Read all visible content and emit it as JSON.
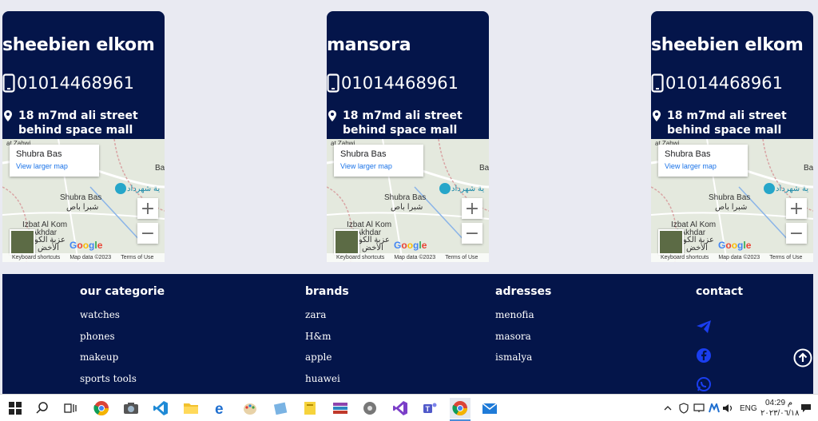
{
  "cards": [
    {
      "title": "sheebien elkom",
      "phone": "01014468961",
      "address": "18 m7md ali street behind space mall"
    },
    {
      "title": "mansora",
      "phone": "01014468961",
      "address": "18 m7md ali street behind space mall"
    },
    {
      "title": "sheebien elkom",
      "phone": "01014468961",
      "address": "18 m7md ali street behind space mall"
    }
  ],
  "map": {
    "place_name": "Shubra Bas",
    "view_larger": "View larger map",
    "town_en": "Shubra Bas",
    "town_ar": "شبرا باص",
    "izbat_en": "Izbat Al Kom",
    "izbat_en2": "l Akhdar",
    "izbat_ar": "عزبة الكو",
    "izbat_ar2": "الأخض",
    "poi_ar": "ية شهرداد",
    "top_label": "at Zahwi",
    "side_label": "Ba",
    "zoom_in": "+",
    "zoom_out": "−",
    "google": "Google",
    "shortcuts": "Keyboard shortcuts",
    "mapdata": "Map data ©2023",
    "terms": "Terms of Use"
  },
  "footer": {
    "categories": {
      "title": "our categorie",
      "items": [
        "watches",
        "phones",
        "makeup",
        "sports tools"
      ]
    },
    "brands": {
      "title": "brands",
      "items": [
        "zara",
        "H&m",
        "apple",
        "huawei"
      ]
    },
    "addresses": {
      "title": "adresses",
      "items": [
        "menofia",
        "masora",
        "ismalya"
      ]
    },
    "contact": {
      "title": "contact"
    }
  },
  "taskbar": {
    "lang": "ENG",
    "time": "04:29 م",
    "date": "٢٠٢٣/٠٦/١٨"
  },
  "colors": {
    "navy": "#04154a",
    "page": "#e9eaf2",
    "social_blue": "#1a3ef0"
  }
}
